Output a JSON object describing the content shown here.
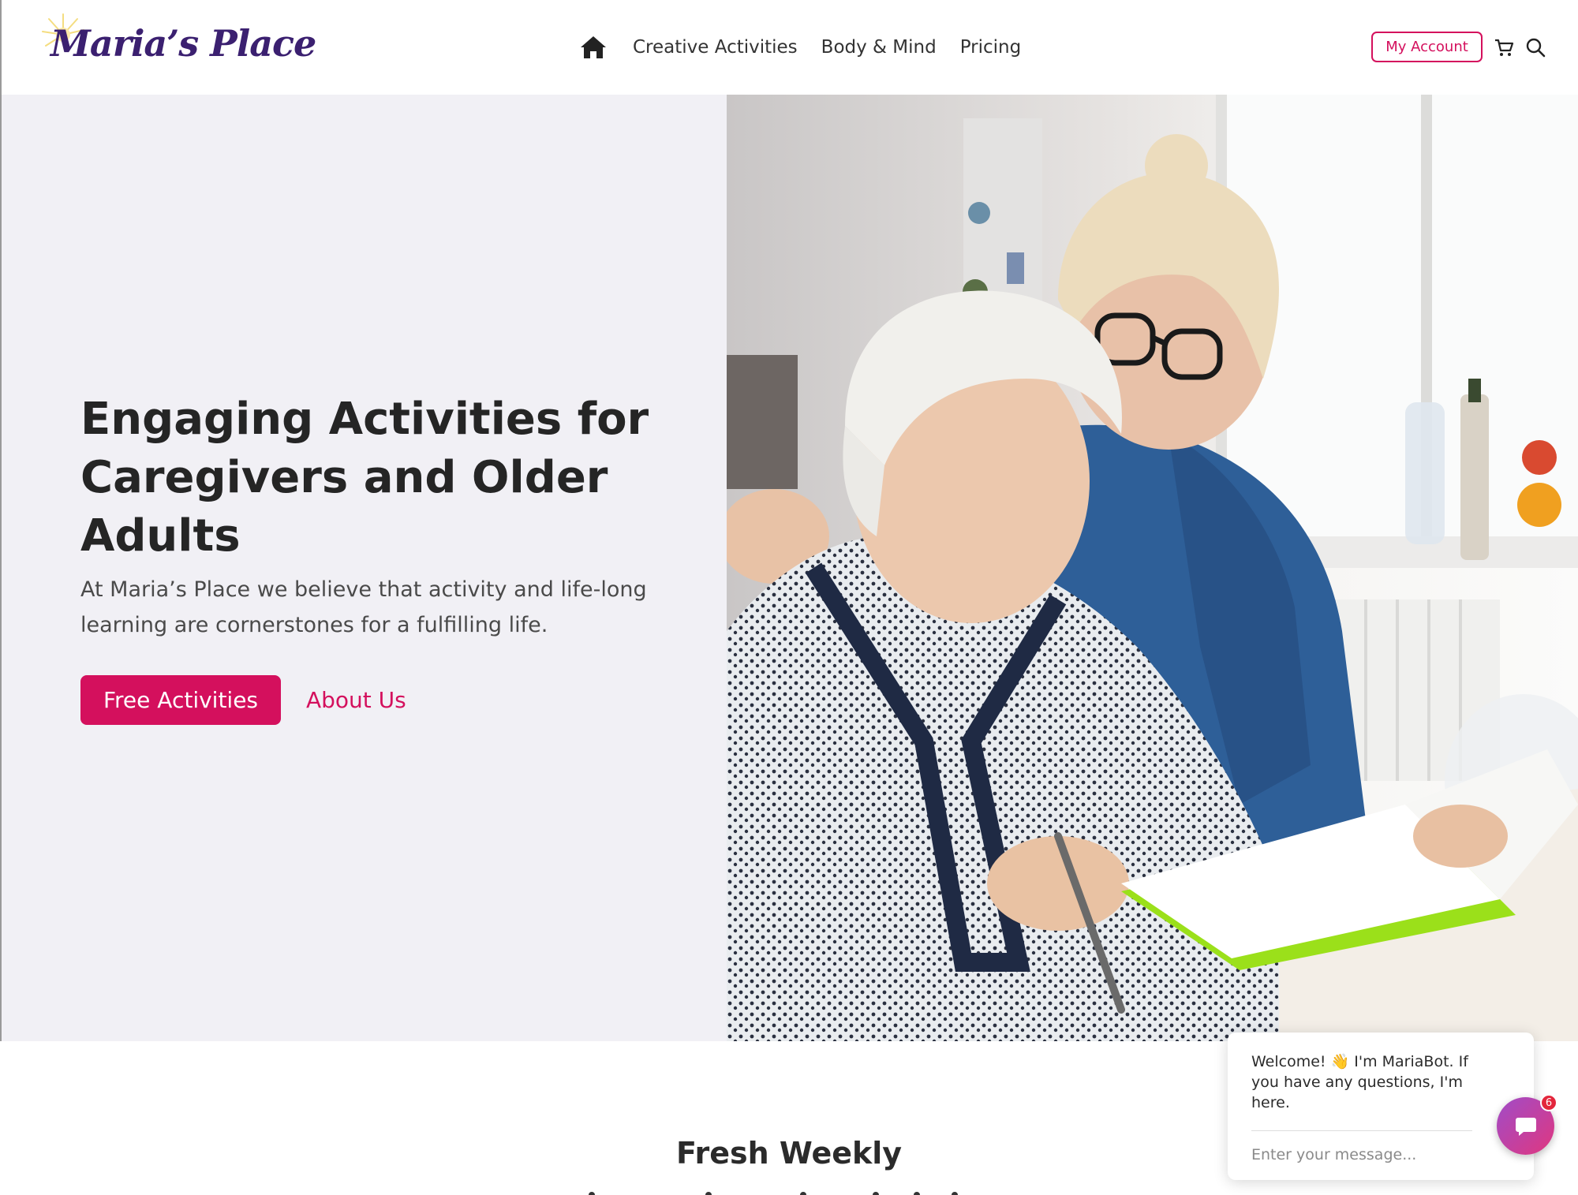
{
  "brand": {
    "name": "Maria’s Place"
  },
  "nav": {
    "items": [
      {
        "label": "Creative Activities"
      },
      {
        "label": "Body & Mind"
      },
      {
        "label": "Pricing"
      }
    ],
    "account_label": "My Account"
  },
  "hero": {
    "title": "Engaging Activities for Caregivers and Older Adults",
    "subtitle": "At Maria’s Place we believe that activity and life-long learning are cornerstones for a fulfilling life.",
    "primary_button": "Free Activities",
    "secondary_link": "About Us"
  },
  "section": {
    "title": "Fresh Weekly"
  },
  "chat": {
    "message": "Welcome! 👋 I'm MariaBot. If you have any questions, I'm here.",
    "placeholder": "Enter your message...",
    "badge_count": "6"
  },
  "colors": {
    "accent": "#d4105d",
    "brand_purple": "#3b2070",
    "hero_bg": "#f1f0f5"
  },
  "icons": [
    "home-icon",
    "cart-icon",
    "search-icon",
    "chat-icon"
  ]
}
